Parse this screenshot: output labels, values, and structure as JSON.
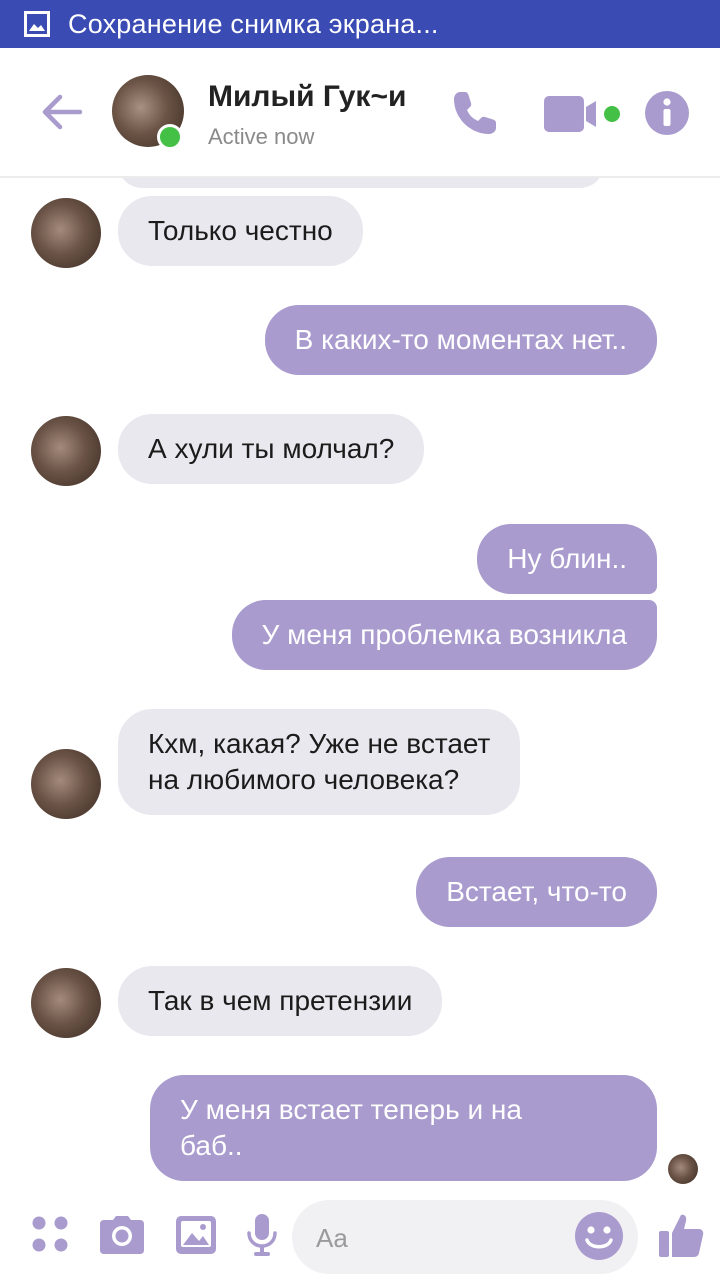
{
  "status_bar": {
    "notification": "Сохранение снимка экрана..."
  },
  "header": {
    "contact_name": "Милый Гук~и",
    "presence": "Active now"
  },
  "messages": [
    {
      "dir": "in",
      "lines": [
        "Только честно"
      ]
    },
    {
      "dir": "out",
      "lines": [
        "В каких-то моментах нет.."
      ]
    },
    {
      "dir": "in",
      "lines": [
        "А хули ты молчал?"
      ]
    },
    {
      "dir": "out",
      "lines": [
        "Ну блин.."
      ]
    },
    {
      "dir": "out",
      "lines": [
        "У меня проблемка возникла"
      ]
    },
    {
      "dir": "in",
      "lines": [
        "Кхм, какая? Уже не встает",
        "на любимого человека?"
      ]
    },
    {
      "dir": "out",
      "lines": [
        "Встает, что-то"
      ]
    },
    {
      "dir": "in",
      "lines": [
        "Так в чем претензии"
      ]
    },
    {
      "dir": "out",
      "lines": [
        "У меня встает теперь и на",
        "баб.."
      ]
    }
  ],
  "composer": {
    "placeholder": "Aa"
  },
  "colors": {
    "accent": "#a99bce",
    "status_bar": "#3a4bb3",
    "incoming_bubble": "#e9e8ee",
    "online": "#44c046"
  },
  "icons": {
    "back": "arrow-left-icon",
    "call": "phone-icon",
    "video": "video-camera-icon",
    "info": "info-icon",
    "apps": "four-dots-icon",
    "camera": "camera-icon",
    "gallery": "image-icon",
    "mic": "microphone-icon",
    "emoji": "smiley-icon",
    "like": "thumbs-up-icon"
  }
}
